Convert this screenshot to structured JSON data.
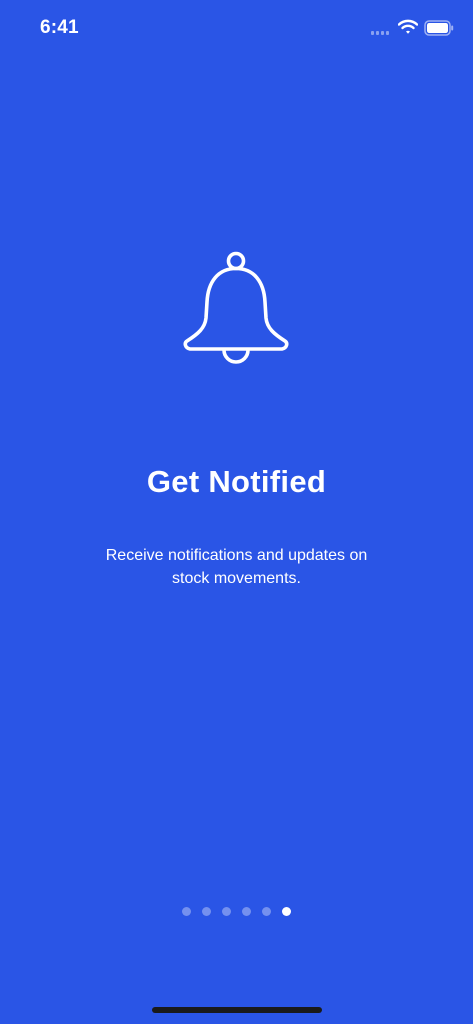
{
  "status_bar": {
    "time": "6:41"
  },
  "slide": {
    "icon": "bell-icon",
    "title": "Get Notified",
    "description": "Receive notifications and updates on stock movements."
  },
  "pager": {
    "count": 6,
    "active_index": 5
  },
  "colors": {
    "background": "#2a55e6",
    "text": "#ffffff"
  }
}
